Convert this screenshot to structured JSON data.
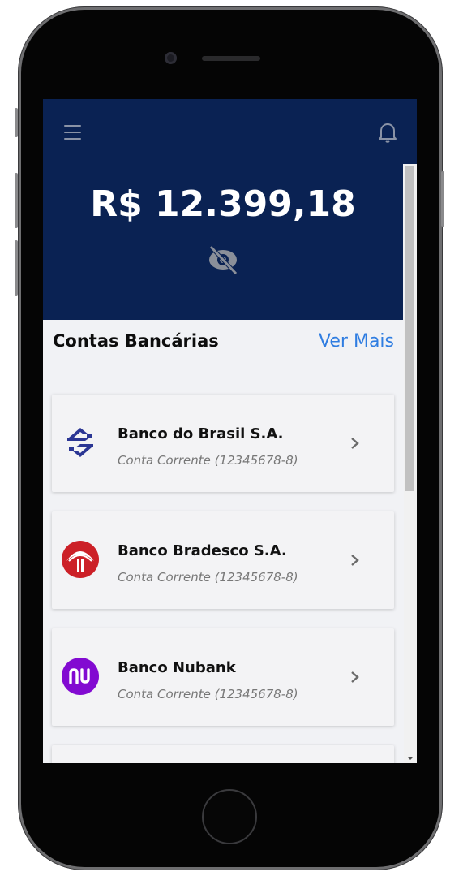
{
  "header": {
    "balance": "R$ 12.399,18"
  },
  "section": {
    "title": "Contas Bancárias",
    "see_more": "Ver Mais"
  },
  "accounts": [
    {
      "name": "Banco do Brasil S.A.",
      "detail": "Conta Corrente (12345678-8)",
      "logo": "banco-do-brasil-logo"
    },
    {
      "name": "Banco Bradesco S.A.",
      "detail": "Conta Corrente (12345678-8)",
      "logo": "bradesco-logo"
    },
    {
      "name": "Banco Nubank",
      "detail": "Conta Corrente (12345678-8)",
      "logo": "nubank-logo"
    }
  ],
  "colors": {
    "header_bg": "#0a2253",
    "link": "#2f7de1",
    "bb_blue": "#2b3694",
    "bradesco_red": "#cc2027",
    "nubank_purple": "#820ad1"
  },
  "icons": [
    "menu-icon",
    "bell-icon",
    "eye-off-icon",
    "chevron-right-icon"
  ]
}
